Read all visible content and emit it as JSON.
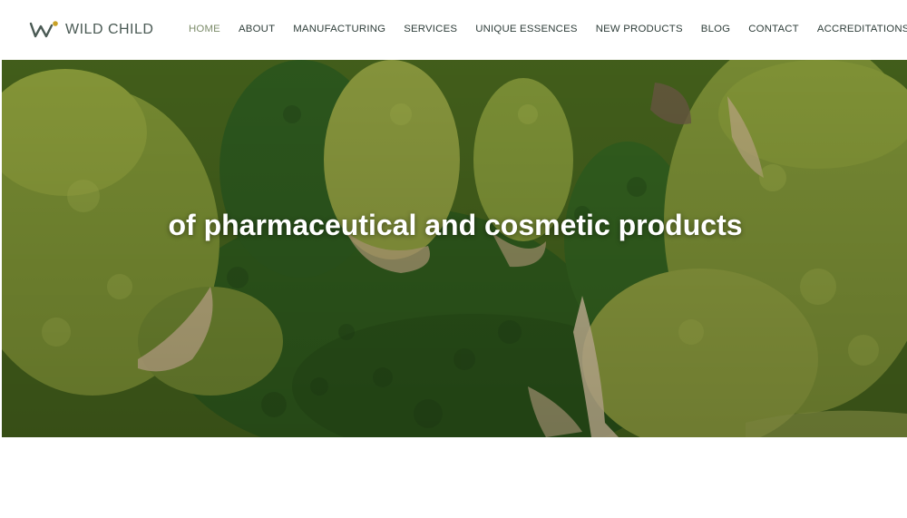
{
  "brand": {
    "name": "WILD CHILD",
    "logo_icon": "wild-child-logo-mark",
    "accent_color": "#c9a227",
    "mark_color": "#4a5a54"
  },
  "nav": {
    "items": [
      {
        "label": "HOME",
        "active": true
      },
      {
        "label": "ABOUT",
        "active": false
      },
      {
        "label": "MANUFACTURING",
        "active": false
      },
      {
        "label": "SERVICES",
        "active": false
      },
      {
        "label": "UNIQUE ESSENCES",
        "active": false
      },
      {
        "label": "NEW PRODUCTS",
        "active": false
      },
      {
        "label": "BLOG",
        "active": false
      },
      {
        "label": "CONTACT",
        "active": false
      },
      {
        "label": "ACCREDITATIONS",
        "active": false
      }
    ],
    "active_color": "#7c8c6a",
    "text_color": "#2f3e3a"
  },
  "hero": {
    "image": "aerial-forest-canyon-image",
    "text": "of pharmaceutical and cosmetic products"
  },
  "section": {
    "heading_color": "#8a9a5b"
  }
}
